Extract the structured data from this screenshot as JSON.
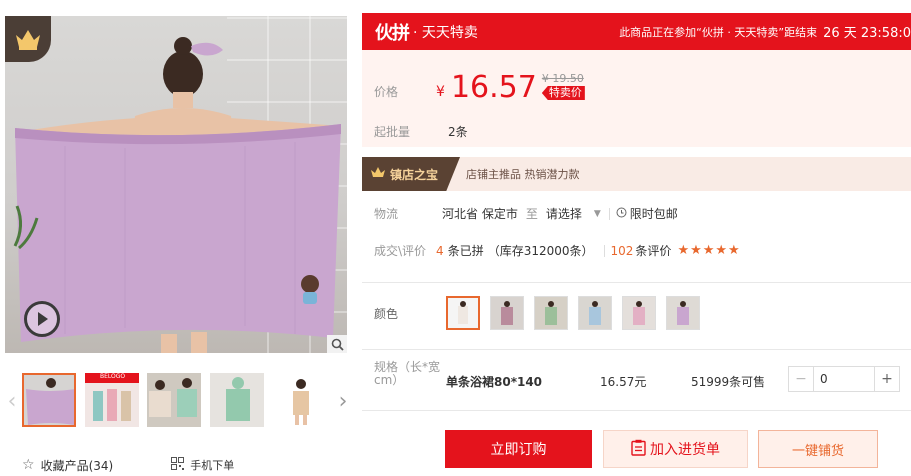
{
  "gallery": {
    "thumbnails": [
      "thumb-1",
      "thumb-2",
      "thumb-3",
      "thumb-4",
      "thumb-5"
    ],
    "thumb_caption": "BELOGO",
    "favorites_label": "收藏产品(34)",
    "mobile_label": "手机下单"
  },
  "promo": {
    "logo": "伙拼",
    "name": "· 天天特卖",
    "notice": "此商品正在参加“伙拼 · 天天特卖”距结束",
    "countdown": "26 天 23:58:0"
  },
  "price": {
    "label": "价格",
    "currency": "¥",
    "value": "16.57",
    "original": "¥ 19.50",
    "tag": "特卖价"
  },
  "moq": {
    "label": "起批量",
    "value": "2条"
  },
  "treasure": {
    "badge": "镇店之宝",
    "text": "店铺主推品  热销潜力款"
  },
  "logistics": {
    "label": "物流",
    "from": "河北省 保定市",
    "to_word": "至",
    "select": "请选择",
    "free_shipping": "限时包邮"
  },
  "deals": {
    "label": "成交\\评价",
    "count": "4",
    "count_suffix": "条已拼",
    "stock": "（库存312000条）",
    "reviews": "102",
    "reviews_suffix": "条评价",
    "stars": "★★★★★"
  },
  "color": {
    "label": "颜色"
  },
  "spec": {
    "label": "规格（长*宽cm）",
    "name": "单条浴裙80*140",
    "price": "16.57元",
    "stock": "51999条可售",
    "qty": "0"
  },
  "actions": {
    "buy": "立即订购",
    "cart": "加入进货单",
    "distribute": "一键铺货"
  },
  "colors": {
    "accent": "#e4131c",
    "orange": "#e8682e",
    "towel": "#c9a6cf"
  }
}
